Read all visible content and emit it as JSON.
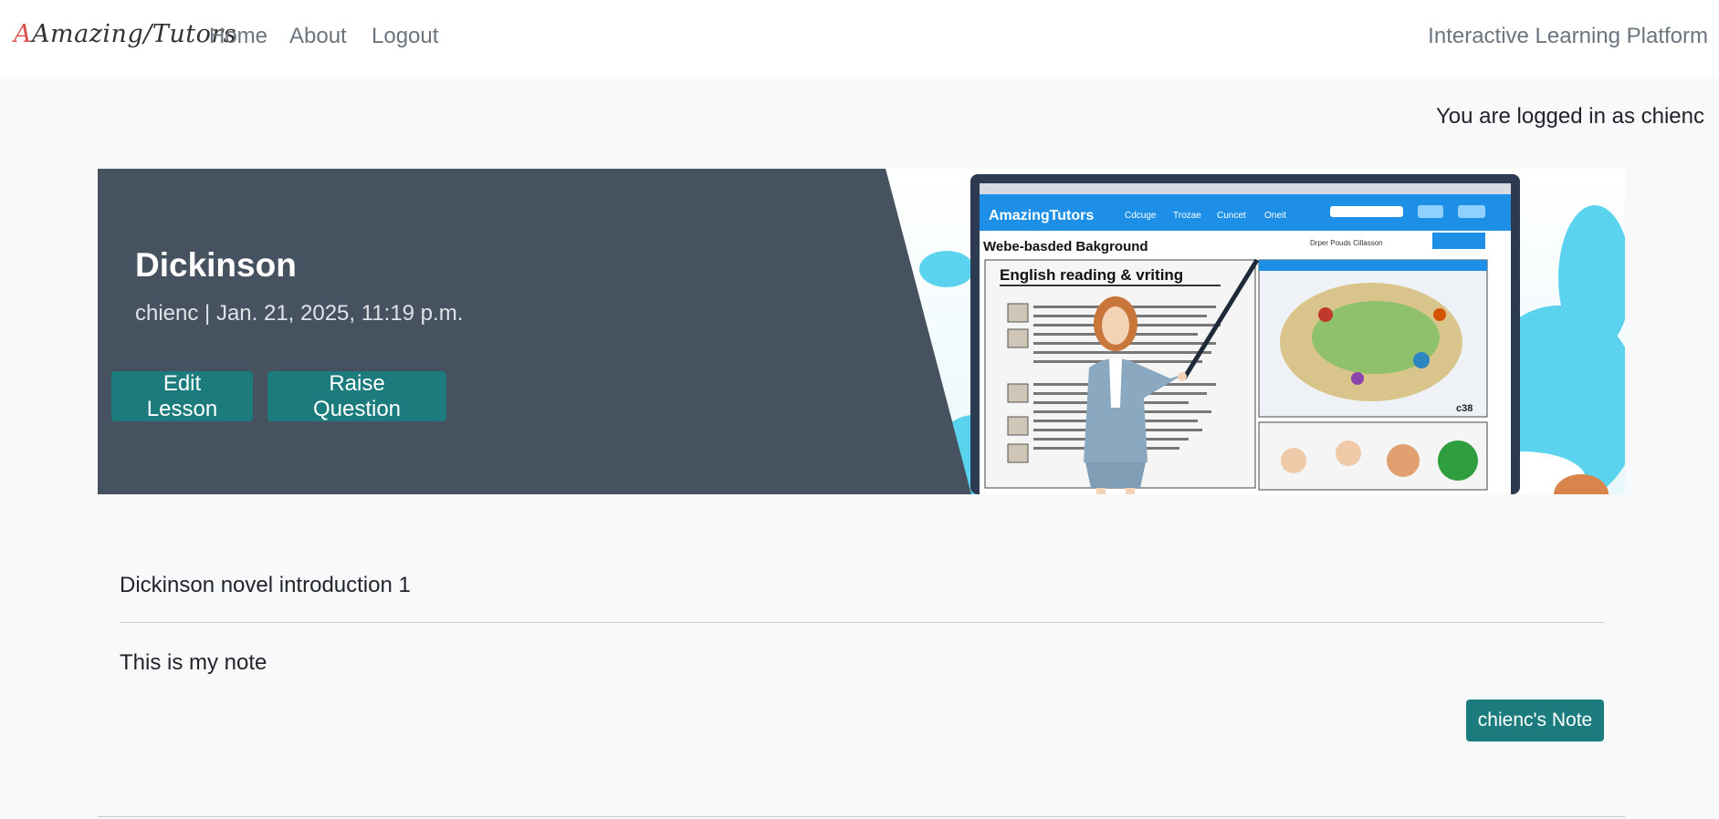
{
  "navbar": {
    "brand_left": "Amazing",
    "brand_sep": "/",
    "brand_right": "Tutors",
    "links": [
      "Home",
      "About",
      "Logout"
    ],
    "right_text": "Interactive Learning Platform"
  },
  "user_status": "You are logged in as chienc",
  "hero": {
    "title": "Dickinson",
    "meta": "chienc | Jan. 21, 2025, 11:19 p.m.",
    "edit_button": "Edit Lesson",
    "question_button": "Raise Question",
    "image": {
      "site_name": "AmazingTutors",
      "nav_items": [
        "Cdcuge",
        "Trozae",
        "Cuncet",
        "Oneit"
      ],
      "page_heading": "Webe-basded Bakground",
      "card_heading": "English   reading & vriting",
      "side_label": "Drper Pouds Cillasson",
      "map_label": "c38"
    }
  },
  "lesson": {
    "description": "Dickinson novel introduction 1",
    "note": "This is my note",
    "note_button": "chienc's Note"
  },
  "colors": {
    "accent_teal": "#1c7c7d",
    "hero_bg": "#465260",
    "brand_accent": "#d9534f"
  }
}
